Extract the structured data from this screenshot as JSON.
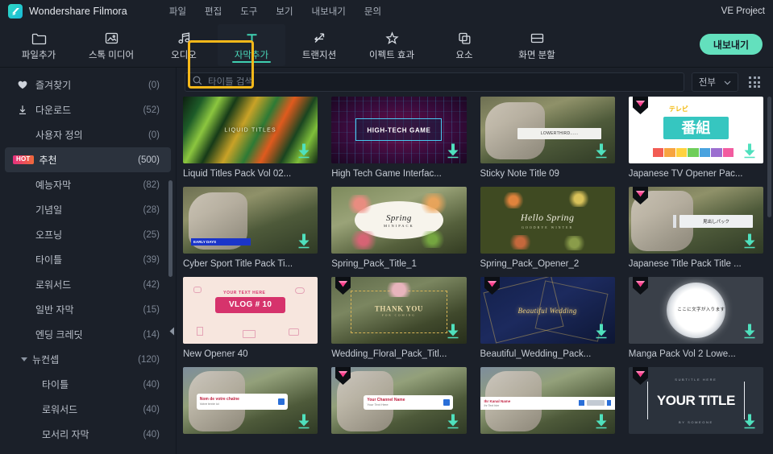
{
  "titlebar": {
    "brand": "Wondershare Filmora",
    "project_name": "VE Project",
    "menus": [
      {
        "label": "파일",
        "name": "menu-file"
      },
      {
        "label": "편집",
        "name": "menu-edit"
      },
      {
        "label": "도구",
        "name": "menu-tools"
      },
      {
        "label": "보기",
        "name": "menu-view"
      },
      {
        "label": "내보내기",
        "name": "menu-export"
      },
      {
        "label": "문의",
        "name": "menu-contact"
      }
    ]
  },
  "toolbar": {
    "export_label": "내보내기",
    "active_index": 3,
    "highlight_color": "#f5b81a",
    "accent_color": "#3fcfb0",
    "items": [
      {
        "label": "파일추가",
        "icon": "folder-icon"
      },
      {
        "label": "스톡 미디어",
        "icon": "image-stack-icon"
      },
      {
        "label": "오디오",
        "icon": "music-note-icon"
      },
      {
        "label": "자막추가",
        "icon": "text-t-icon"
      },
      {
        "label": "트랜지션",
        "icon": "transition-arrows-icon"
      },
      {
        "label": "이펙트 효과",
        "icon": "sparkle-star-icon"
      },
      {
        "label": "요소",
        "icon": "copy-layers-icon"
      },
      {
        "label": "화면 분할",
        "icon": "split-screen-icon"
      }
    ]
  },
  "sidebar": {
    "selected_index": 3,
    "items": [
      {
        "label": "즐겨찾기",
        "count": "(0)",
        "icon": "heart-icon",
        "indent": 0
      },
      {
        "label": "다운로드",
        "count": "(52)",
        "icon": "download-icon",
        "indent": 0
      },
      {
        "label": "사용자 정의",
        "count": "(0)",
        "icon": "",
        "indent": 0
      },
      {
        "label": "추천",
        "count": "(500)",
        "icon": "",
        "badge": "HOT",
        "indent": 0
      },
      {
        "label": "예능자막",
        "count": "(82)",
        "icon": "",
        "indent": 0
      },
      {
        "label": "기념일",
        "count": "(28)",
        "icon": "",
        "indent": 0
      },
      {
        "label": "오프닝",
        "count": "(25)",
        "icon": "",
        "indent": 0
      },
      {
        "label": "타이틀",
        "count": "(39)",
        "icon": "",
        "indent": 0
      },
      {
        "label": "로워서드",
        "count": "(42)",
        "icon": "",
        "indent": 0
      },
      {
        "label": "일반 자막",
        "count": "(15)",
        "icon": "",
        "indent": 0
      },
      {
        "label": "엔딩 크레딧",
        "count": "(14)",
        "icon": "",
        "indent": 0
      },
      {
        "label": "뉴컨셉",
        "count": "(120)",
        "icon": "caret-down-icon",
        "indent": 0
      },
      {
        "label": "타이틀",
        "count": "(40)",
        "icon": "",
        "indent": 1
      },
      {
        "label": "로워서드",
        "count": "(40)",
        "icon": "",
        "indent": 1
      },
      {
        "label": "모서리 자막",
        "count": "(40)",
        "icon": "",
        "indent": 1
      }
    ]
  },
  "search": {
    "placeholder": "타이틀 검색",
    "value": "",
    "filter_value": "전부"
  },
  "grid": {
    "cards": [
      {
        "title": "Liquid Titles Pack Vol 02...",
        "art": "liquid",
        "gem": false,
        "download": true,
        "art_text": "LIQUID TITLES"
      },
      {
        "title": "High Tech Game Interfac...",
        "art": "hightech",
        "gem": false,
        "download": true,
        "art_text": "HIGH-TECH GAME"
      },
      {
        "title": "Sticky Note Title 09",
        "art": "photo",
        "gem": false,
        "download": true,
        "art_text": "LOWERTHIRD......"
      },
      {
        "title": "Japanese TV Opener Pac...",
        "art": "japanese-tv",
        "gem": true,
        "download": true,
        "art_text": "番組"
      },
      {
        "title": "Cyber Sport Title Pack Ti...",
        "art": "photo-cyber",
        "gem": false,
        "download": true,
        "art_text": "EARLY DAYS"
      },
      {
        "title": "Spring_Pack_Title_1",
        "art": "spring",
        "gem": false,
        "download": false,
        "art_text": "Spring"
      },
      {
        "title": "Spring_Pack_Opener_2",
        "art": "hello-spring",
        "gem": false,
        "download": false,
        "art_text": "Hello Spring"
      },
      {
        "title": "Japanese Title Pack Title ...",
        "art": "photo-jp",
        "gem": true,
        "download": true,
        "art_text": "見出しパック"
      },
      {
        "title": "New Opener 40",
        "art": "vlog",
        "gem": false,
        "download": false,
        "art_text": "VLOG # 10"
      },
      {
        "title": "Wedding_Floral_Pack_Titl...",
        "art": "wedding-floral",
        "gem": true,
        "download": true,
        "art_text": "THANK YOU"
      },
      {
        "title": "Beautiful_Wedding_Pack...",
        "art": "beautiful-wedding",
        "gem": true,
        "download": true,
        "art_text": "Beautiful Wedding"
      },
      {
        "title": "Manga Pack Vol 2 Lowe...",
        "art": "manga",
        "gem": true,
        "download": true,
        "art_text": "ここに文字が入ります"
      },
      {
        "title": "",
        "art": "photo-fr",
        "gem": false,
        "download": true,
        "art_text": "Nom de votre chaîne"
      },
      {
        "title": "",
        "art": "photo-channel",
        "gem": true,
        "download": true,
        "art_text": "Your Channel Name"
      },
      {
        "title": "",
        "art": "photo-kanal",
        "gem": false,
        "download": true,
        "art_text": "Ihr Kanal Name"
      },
      {
        "title": "",
        "art": "your-title",
        "gem": true,
        "download": true,
        "art_text": "YOUR TITLE"
      }
    ]
  }
}
